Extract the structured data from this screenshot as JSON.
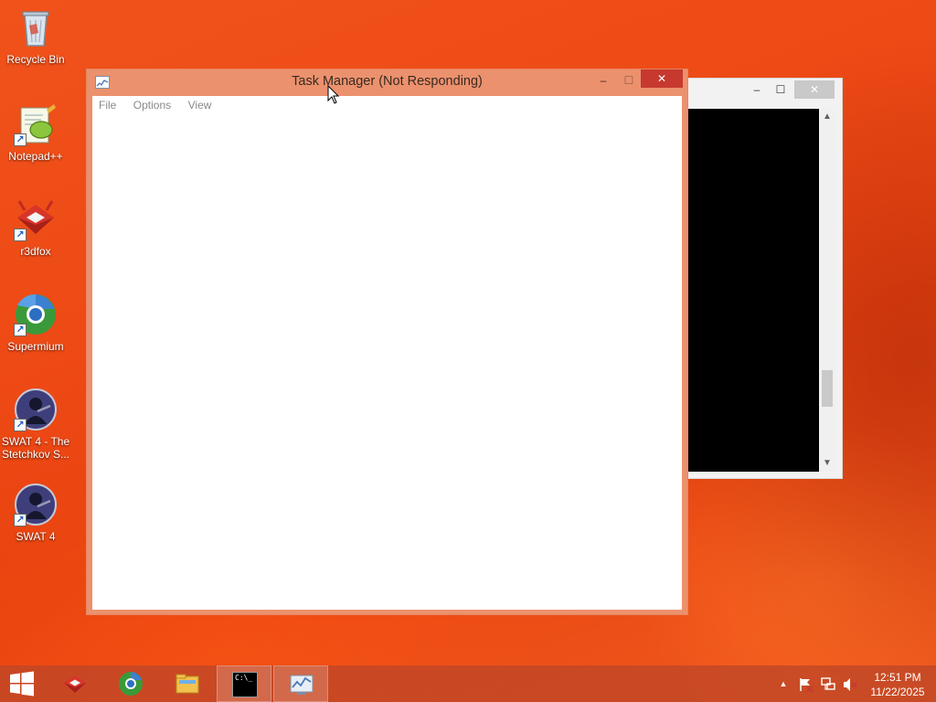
{
  "desktop": {
    "icons": [
      {
        "label": "Recycle Bin",
        "icon": "recycle-bin-icon"
      },
      {
        "label": "Notepad++",
        "icon": "notepad-plus-plus-icon"
      },
      {
        "label": "r3dfox",
        "icon": "r3dfox-icon"
      },
      {
        "label": "Supermium",
        "icon": "supermium-icon"
      },
      {
        "label": "SWAT 4 - The Stetchkov S...",
        "icon": "swat4-icon"
      },
      {
        "label": "SWAT 4",
        "icon": "swat4-icon"
      }
    ]
  },
  "task_manager": {
    "title": "Task Manager (Not Responding)",
    "menu": [
      "File",
      "Options",
      "View"
    ],
    "controls": {
      "minimize": "‒",
      "maximize": "☐",
      "close": "✕"
    }
  },
  "console_window": {
    "controls": {
      "minimize": "‒",
      "maximize": "☐",
      "close": "✕"
    },
    "scroll_up": "▲",
    "scroll_down": "▼"
  },
  "taskbar": {
    "buttons": [
      {
        "name": "r3dfox",
        "icon": "r3dfox-icon"
      },
      {
        "name": "Supermium",
        "icon": "supermium-icon"
      },
      {
        "name": "File Explorer",
        "icon": "folder-icon"
      },
      {
        "name": "Command Prompt",
        "icon": "cmd-icon",
        "active": true,
        "glyph": "C:\\_"
      },
      {
        "name": "Task Manager",
        "icon": "task-manager-icon",
        "active": true
      }
    ],
    "tray": {
      "show_hidden": "▲",
      "action_center": "flag-icon",
      "network": "network-icon",
      "volume": "volume-muted-icon"
    },
    "clock": {
      "time": "12:51 PM",
      "date": "11/22/2025"
    }
  },
  "colors": {
    "desktop_bg": "#ee4a16",
    "active_window_frame": "#ec916d",
    "close_button": "#c7392f",
    "taskbar": "#be4628"
  }
}
